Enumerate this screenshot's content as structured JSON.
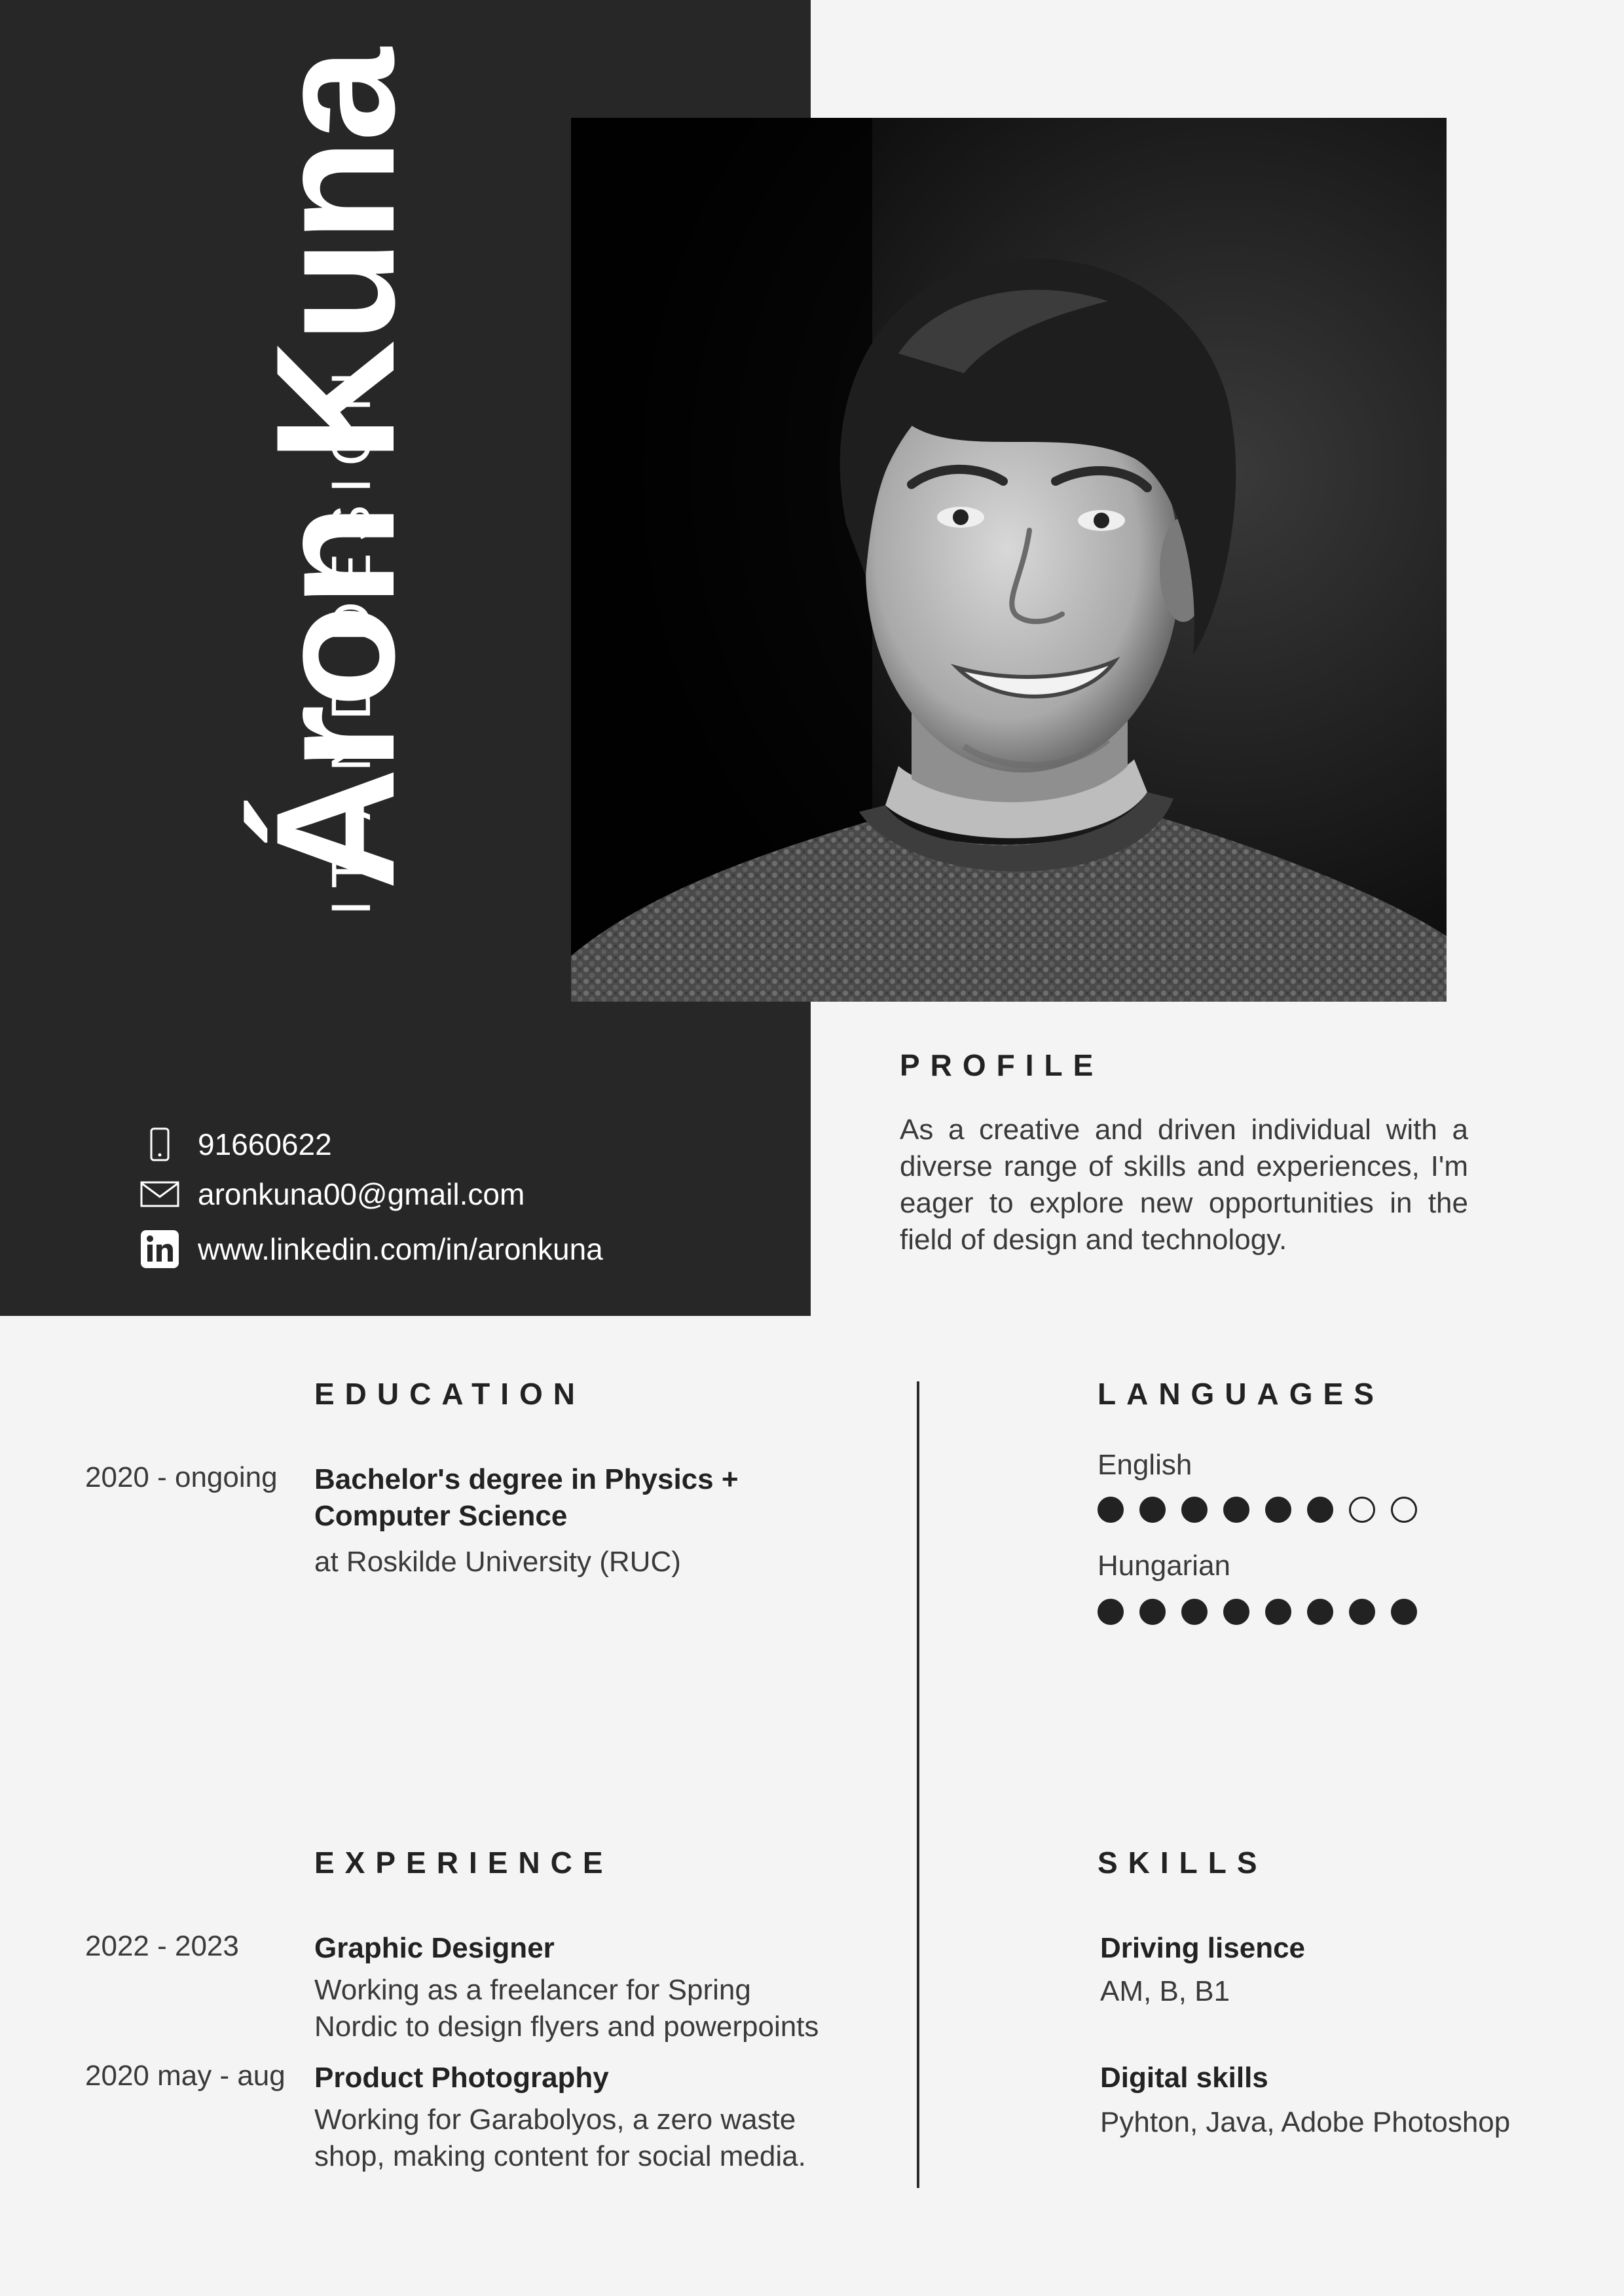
{
  "header": {
    "name": "Áron Kuna",
    "title": "IT AND DESIGN"
  },
  "contact": {
    "phone": "91660622",
    "email": "aronkuna00@gmail.com",
    "linkedin": "www.linkedin.com/in/aronkuna",
    "icons": [
      "phone-icon",
      "mail-icon",
      "linkedin-icon"
    ]
  },
  "profile": {
    "heading": "PROFILE",
    "text": "As a creative and driven individual with a diverse range of skills and experiences, I'm eager to explore new opportunities in the field of design and technology."
  },
  "education": {
    "heading": "EDUCATION",
    "entries": [
      {
        "date": "2020 - ongoing",
        "degree_line1": "Bachelor's degree in Physics +",
        "degree_line2": "Computer Science",
        "place": "at Roskilde University (RUC)"
      }
    ]
  },
  "experience": {
    "heading": "EXPERIENCE",
    "entries": [
      {
        "date": "2022 - 2023",
        "role": "Graphic Designer",
        "line1": "Working as a freelancer for Spring",
        "line2": "Nordic to design flyers and powerpoints"
      },
      {
        "date": "2020 may - aug",
        "role": "Product Photography",
        "line1": "Working for Garabolyos, a zero waste",
        "line2": "shop, making content for social media."
      }
    ]
  },
  "languages": {
    "heading": "LANGUAGES",
    "items": [
      {
        "name": "English",
        "level": 6,
        "max": 8
      },
      {
        "name": "Hungarian",
        "level": 8,
        "max": 8
      }
    ]
  },
  "skills": {
    "heading": "SKILLS",
    "items": [
      {
        "title": "Driving lisence",
        "detail": "AM, B, B1"
      },
      {
        "title": "Digital skills",
        "detail": "Pyhton, Java, Adobe Photoshop"
      }
    ]
  },
  "colors": {
    "dark_panel": "#272727",
    "page_background": "#f4f4f4",
    "text": "#2b2b2b"
  }
}
